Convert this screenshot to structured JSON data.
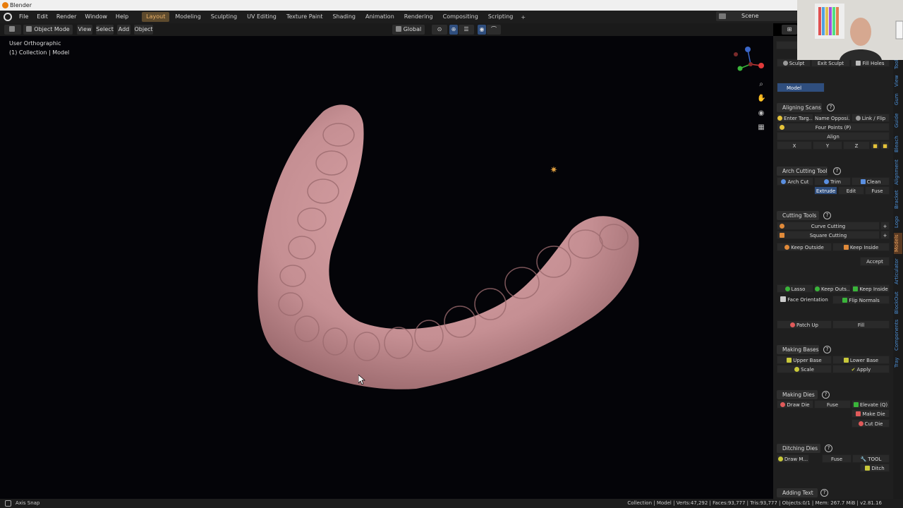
{
  "window": {
    "title": "Blender"
  },
  "menu": {
    "items": [
      "File",
      "Edit",
      "Render",
      "Window",
      "Help"
    ],
    "workspaces": [
      "Layout",
      "Modeling",
      "Sculpting",
      "UV Editing",
      "Texture Paint",
      "Shading",
      "Animation",
      "Rendering",
      "Compositing",
      "Scripting"
    ],
    "active_workspace": "Layout",
    "add_workspace": "+",
    "scene": "Scene"
  },
  "header": {
    "mode": "Object Mode",
    "view": "View",
    "select": "Select",
    "add": "Add",
    "object": "Object",
    "transform_orientation": "Global"
  },
  "viewport": {
    "view_name": "User Orthographic",
    "collection": "(1) Collection | Model",
    "model_color": "#c58f93"
  },
  "sidebar": {
    "top_row": {
      "sculpt": "Sculpt",
      "exit_sculpt": "Exit Sculpt",
      "fill_holes": "Fill Holes"
    },
    "model_field": "Model",
    "aligning": {
      "title": "Aligning Scans",
      "enter_target": "Enter Targ...",
      "name_opposing": "Name Opposi...",
      "link_flip": "Link / Flip",
      "four_points": "Four Points (P)",
      "align": "Align",
      "x": "X",
      "y": "Y",
      "z": "Z"
    },
    "arch": {
      "title": "Arch Cutting Tool",
      "arch_cut": "Arch Cut",
      "trim": "Trim",
      "clean": "Clean",
      "extrude": "Extrude",
      "edit": "Edit",
      "fuse": "Fuse"
    },
    "cutting": {
      "title": "Cutting Tools",
      "curve": "Curve Cutting",
      "square": "Square Cutting",
      "keep_outside": "Keep Outside",
      "keep_inside": "Keep Inside",
      "accept": "Accept"
    },
    "lasso": {
      "lasso": "Lasso",
      "keep_outs": "Keep Outs...",
      "keep_inside": "Keep Inside",
      "face_orientation": "Face Orientation",
      "flip_normals": "Flip Normals"
    },
    "patch": {
      "patch_up": "Patch Up",
      "fill": "Fill"
    },
    "bases": {
      "title": "Making Bases",
      "upper": "Upper Base",
      "lower": "Lower Base",
      "scale": "Scale",
      "apply": "Apply"
    },
    "dies": {
      "title": "Making Dies",
      "draw_die": "Draw Die",
      "fuse": "Fuse",
      "elevate": "Elevate (Q)",
      "make_die": "Make Die",
      "cut_die": "Cut Die"
    },
    "ditching": {
      "title": "Ditching Dies",
      "draw": "Draw M...",
      "fuse": "Fuse",
      "tool": "TOOL",
      "ditch": "Ditch"
    },
    "adding_text": {
      "title": "Adding Text"
    },
    "tabs": [
      "Tool",
      "View",
      "Gum",
      "Guide",
      "Bleach",
      "Alignment",
      "Bracket",
      "Logo",
      "Models",
      "Articulator",
      "BlockOut",
      "Components",
      "Tray"
    ],
    "active_tab": "Models"
  },
  "status": {
    "left": "Axis Snap",
    "right": "Collection | Model | Verts:47,292 | Faces:93,777 | Tris:93,777 | Objects:0/1 | Mem: 267.7 MiB | v2.81.16"
  }
}
